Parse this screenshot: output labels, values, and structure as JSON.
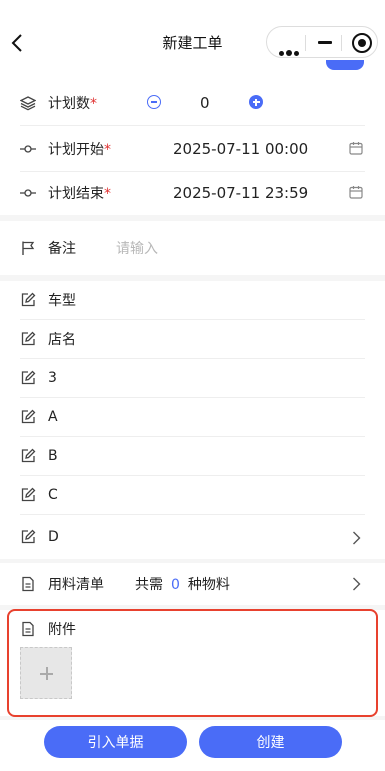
{
  "nav": {
    "title": "新建工单"
  },
  "plan": {
    "quantity_label": "计划数",
    "quantity_value": "0",
    "start_label": "计划开始",
    "start_value": "2025-07-11 00:00",
    "end_label": "计划结束",
    "end_value": "2025-07-11 23:59",
    "required_mark": "*"
  },
  "remark": {
    "label": "备注",
    "placeholder": "请输入"
  },
  "fields": [
    {
      "label": "车型"
    },
    {
      "label": "店名"
    },
    {
      "label": "3"
    },
    {
      "label": "A"
    },
    {
      "label": "B"
    },
    {
      "label": "C"
    },
    {
      "label": "D"
    }
  ],
  "bom": {
    "label": "用料清单",
    "prefix": "共需",
    "count": "0",
    "suffix": "种物料"
  },
  "attachment": {
    "label": "附件"
  },
  "footer": {
    "import_label": "引入单据",
    "create_label": "创建"
  },
  "colors": {
    "accent": "#4a6cf7",
    "required": "#e03131",
    "highlight": "#e8412e"
  }
}
